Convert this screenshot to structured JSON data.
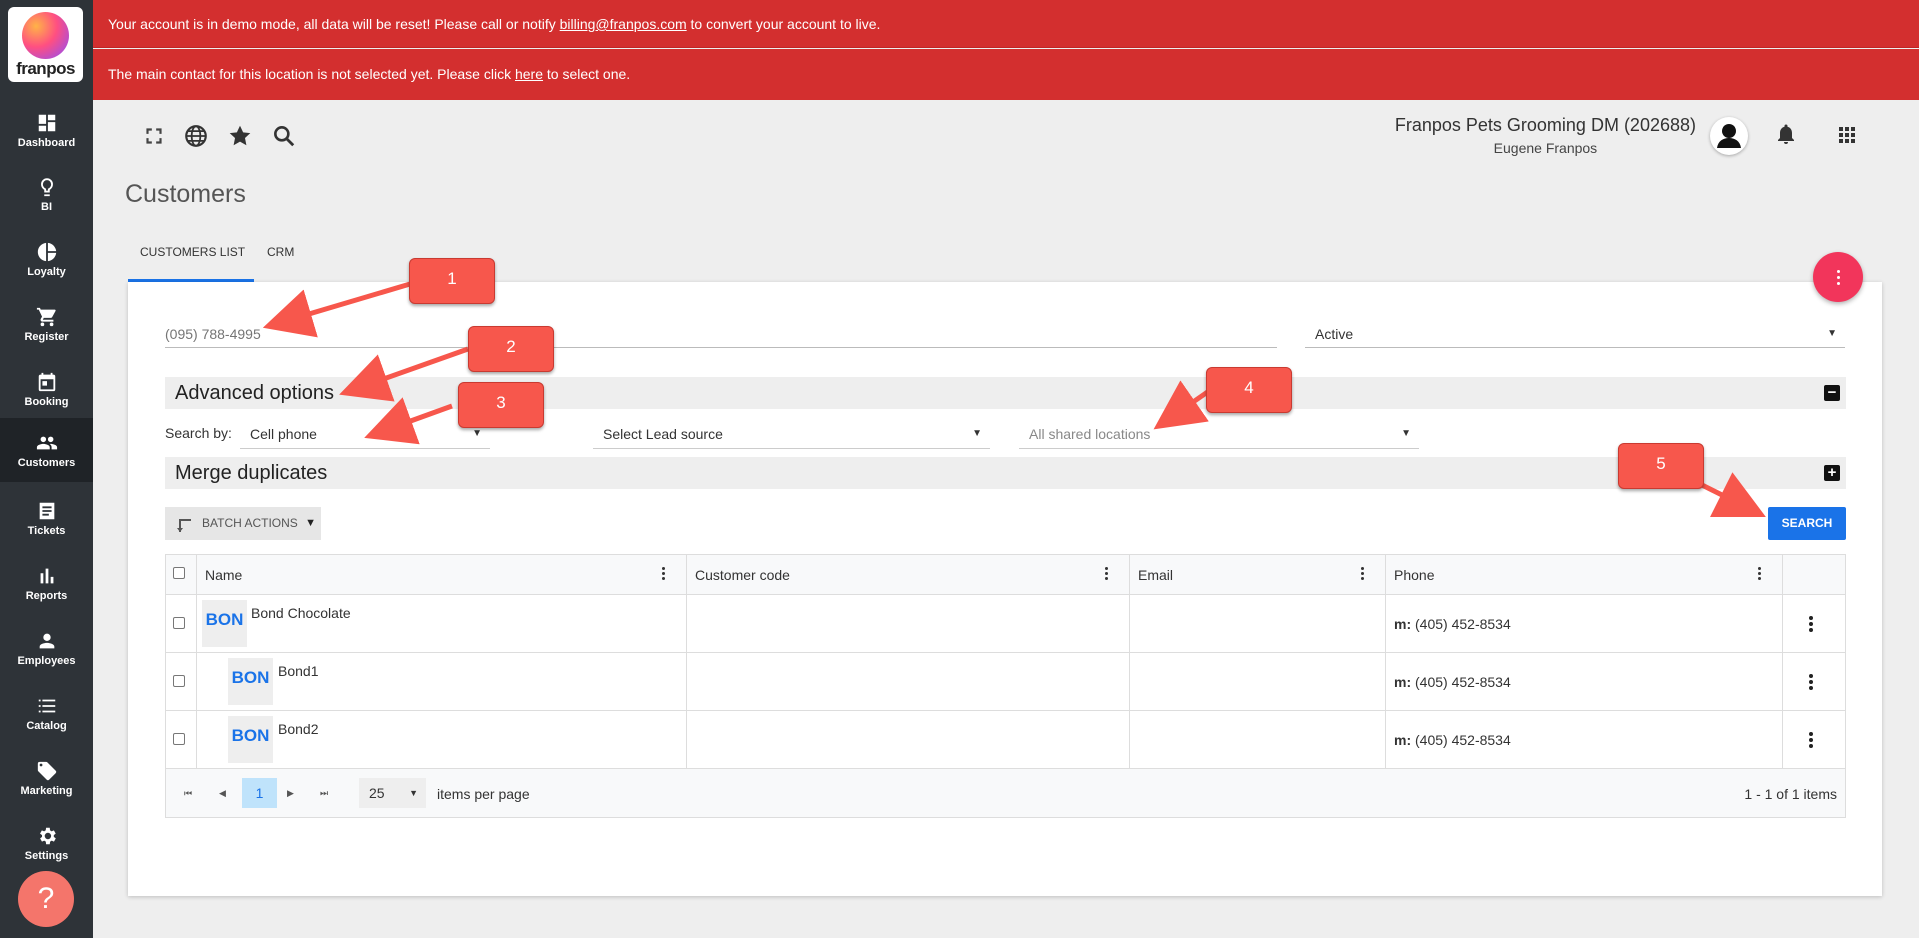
{
  "banners": {
    "demo_pre": "Your account is in demo mode, all data will be reset! Please call or notify ",
    "demo_email": "billing@franpos.com",
    "demo_post": " to convert your account to live.",
    "contact_pre": "The main contact for this location is not selected yet. Please click ",
    "contact_link": "here",
    "contact_post": " to select one."
  },
  "logo": {
    "text": "franpos"
  },
  "sidebar": {
    "items": [
      {
        "label": "Dashboard",
        "icon": "dashboard-icon"
      },
      {
        "label": "BI",
        "icon": "lightbulb-icon"
      },
      {
        "label": "Loyalty",
        "icon": "pie-chart-icon"
      },
      {
        "label": "Register",
        "icon": "cart-icon"
      },
      {
        "label": "Booking",
        "icon": "calendar-icon"
      },
      {
        "label": "Customers",
        "icon": "people-icon"
      },
      {
        "label": "Tickets",
        "icon": "receipt-icon"
      },
      {
        "label": "Reports",
        "icon": "bar-chart-icon"
      },
      {
        "label": "Employees",
        "icon": "person-icon"
      },
      {
        "label": "Catalog",
        "icon": "list-icon"
      },
      {
        "label": "Marketing",
        "icon": "tag-icon"
      },
      {
        "label": "Settings",
        "icon": "gear-icon"
      }
    ],
    "active": "Customers",
    "help": "?"
  },
  "header": {
    "company": "Franpos Pets Grooming DM (202688)",
    "user": "Eugene Franpos"
  },
  "page": {
    "title": "Customers"
  },
  "tabs": [
    {
      "label": "CUSTOMERS LIST",
      "active": true
    },
    {
      "label": "CRM",
      "active": false
    }
  ],
  "filters": {
    "search_placeholder": "(095) 788-4995",
    "status": "Active",
    "advanced_title": "Advanced options",
    "search_by_label": "Search by:",
    "search_by_value": "Cell phone",
    "lead_source": "Select Lead source",
    "locations": "All shared locations",
    "merge_title": "Merge duplicates"
  },
  "actions": {
    "batch": "BATCH ACTIONS",
    "search": "SEARCH"
  },
  "table": {
    "columns": [
      "Name",
      "Customer code",
      "Email",
      "Phone"
    ],
    "rows": [
      {
        "badge": "BON",
        "name": "Bond Chocolate",
        "code": "",
        "email": "",
        "phone_prefix": "m:",
        "phone": "(405) 452-8534"
      },
      {
        "badge": "BON",
        "name": "Bond1",
        "code": "",
        "email": "",
        "phone_prefix": "m:",
        "phone": "(405) 452-8534"
      },
      {
        "badge": "BON",
        "name": "Bond2",
        "code": "",
        "email": "",
        "phone_prefix": "m:",
        "phone": "(405) 452-8534"
      }
    ]
  },
  "pagination": {
    "current_page": "1",
    "per_page": "25",
    "per_page_label": "items per page",
    "summary": "1 - 1 of 1 items"
  },
  "callouts": [
    "1",
    "2",
    "3",
    "4",
    "5"
  ],
  "colors": {
    "banner": "#d32f2f",
    "sidebar": "#2e3338",
    "accent": "#1a73e8",
    "fab": "#f2355b",
    "callout": "#f7574c"
  }
}
